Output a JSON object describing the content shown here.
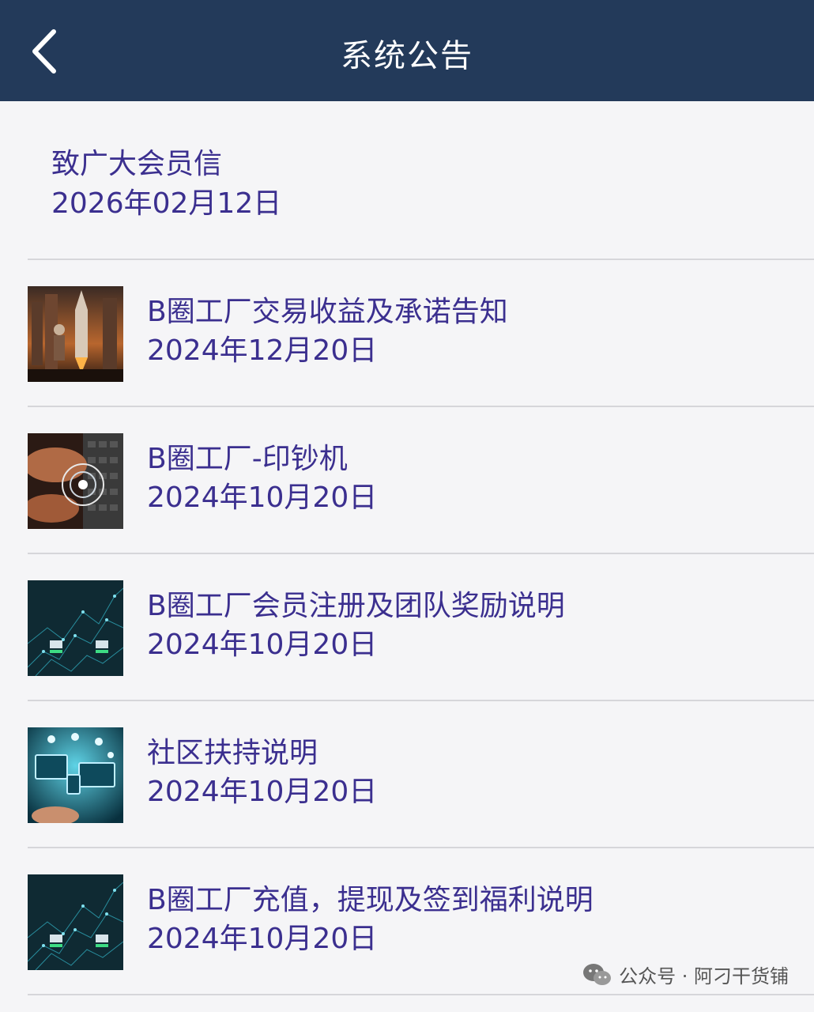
{
  "header": {
    "title": "系统公告",
    "back_icon": "chevron-left-icon"
  },
  "pinned": {
    "title": "致广大会员信",
    "date": "2026年02月12日"
  },
  "items": [
    {
      "title": "B圈工厂交易收益及承诺告知",
      "date": "2024年12月20日",
      "thumb": "rocket-city"
    },
    {
      "title": "B圈工厂-印钞机",
      "date": "2024年10月20日",
      "thumb": "hands-keyboard"
    },
    {
      "title": "B圈工厂会员注册及团队奖励说明",
      "date": "2024年10月20日",
      "thumb": "network-banks"
    },
    {
      "title": "社区扶持说明",
      "date": "2024年10月20日",
      "thumb": "devices-cloud"
    },
    {
      "title": "B圈工厂充值，提现及签到福利说明",
      "date": "2024年10月20日",
      "thumb": "network-banks"
    }
  ],
  "watermark": {
    "text": "公众号 · 阿刁干货铺",
    "icon": "wechat-icon"
  },
  "colors": {
    "header_bg": "#233a5a",
    "text": "#3b2f8f",
    "page_bg": "#f5f5f7"
  }
}
